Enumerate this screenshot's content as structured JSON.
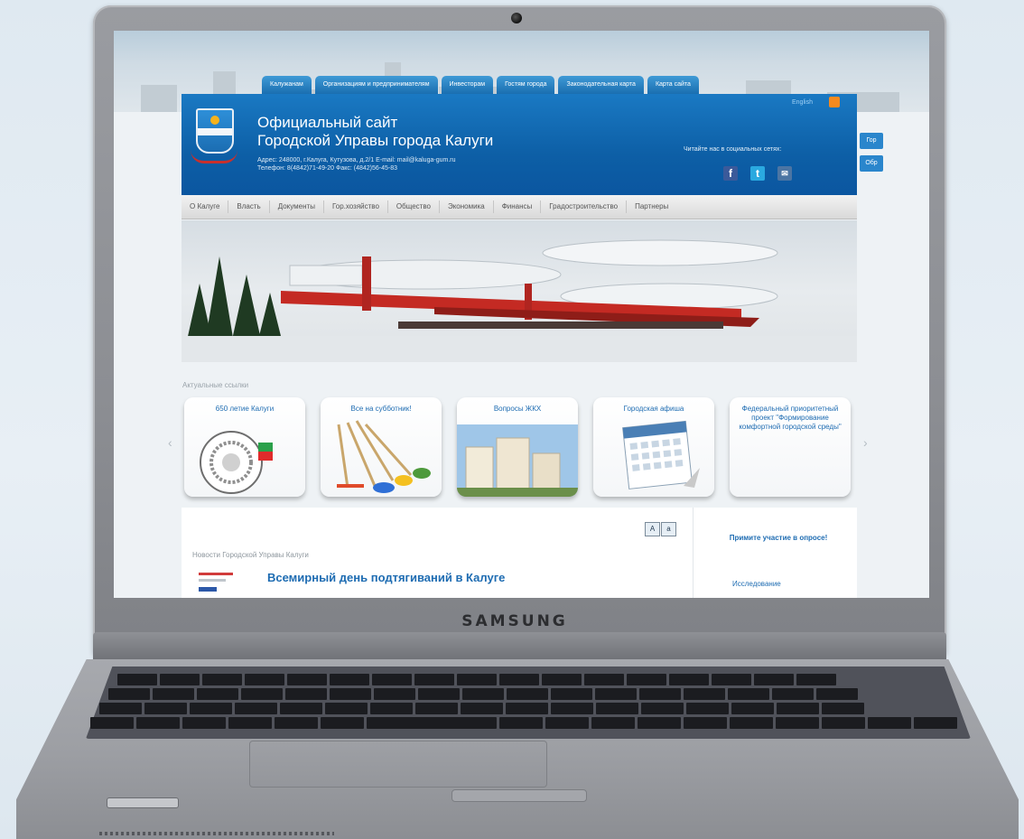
{
  "laptop": {
    "brand": "SAMSUNG"
  },
  "site": {
    "top_nav": [
      "Калужанам",
      "Организациям и предпринимателям",
      "Инвесторам",
      "Гостям города",
      "Законодательная карта",
      "Карта сайта"
    ],
    "english_link": "English",
    "title_line1": "Официальный сайт",
    "title_line2": "Городской Управы города Калуги",
    "address_line": "Адрес: 248000, г.Калуга, Кутузова, д.2/1 E-mail: mail@kaluga-gum.ru",
    "phone_line": "Телефон: 8(4842)71-49-20 Факс: (4842)56-45-83",
    "social_label": "Читайте нас в социальных сетях:",
    "side_tabs": [
      "Гор",
      "Обр"
    ],
    "main_nav": [
      "О Калуге",
      "Власть",
      "Документы",
      "Гор.хозяйство",
      "Общество",
      "Экономика",
      "Финансы",
      "Градостроительство",
      "Партнеры"
    ],
    "section_label": "Актуальные ссылки",
    "cards": [
      "650 летие Калуги",
      "Все на субботник!",
      "Вопросы ЖКХ",
      "Городская афиша",
      "Федеральный приоритетный проект \"Формирование комфортной городской среды\""
    ],
    "news_section_label": "Новости Городской Управы Калуги",
    "news_headline": "Всемирный день подтягиваний в Калуге",
    "font_buttons": [
      "A",
      "a"
    ],
    "poll_title": "Примите участие в опросе!",
    "poll_link": "Исследование"
  },
  "colors": {
    "header_blue": "#0d5fa6",
    "link_blue": "#1e6cb2",
    "tab_blue": "#1a6eb0",
    "rocket_red": "#c42a23"
  },
  "icons": [
    "rss-icon",
    "facebook-icon",
    "twitter-icon",
    "vk-icon",
    "prev-arrow-icon",
    "next-arrow-icon",
    "font-larger-icon",
    "font-smaller-icon"
  ]
}
